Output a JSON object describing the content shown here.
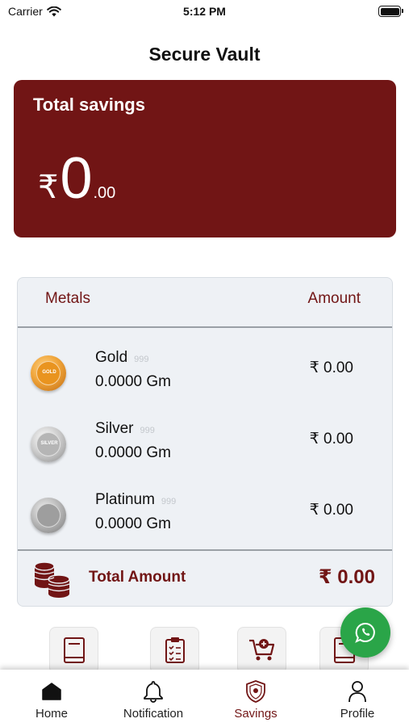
{
  "status_bar": {
    "carrier": "Carrier",
    "time": "5:12 PM"
  },
  "page": {
    "title": "Secure Vault"
  },
  "savings": {
    "label": "Total savings",
    "currency": "₹",
    "integer": "0",
    "decimal": ".00"
  },
  "metals_table": {
    "headers": {
      "metals": "Metals",
      "amount": "Amount"
    },
    "rows": [
      {
        "name": "Gold",
        "purity": "999",
        "weight": "0.0000 Gm",
        "amount": "₹ 0.00",
        "coin_label": "GOLD"
      },
      {
        "name": "Silver",
        "purity": "999",
        "weight": "0.0000 Gm",
        "amount": "₹ 0.00",
        "coin_label": "SILVER"
      },
      {
        "name": "Platinum",
        "purity": "999",
        "weight": "0.0000 Gm",
        "amount": "₹ 0.00",
        "coin_label": ""
      }
    ],
    "total": {
      "label": "Total Amount",
      "value": "₹ 0.00"
    }
  },
  "quick_actions": [
    {
      "icon": "book-icon"
    },
    {
      "icon": "clipboard-checklist-icon"
    },
    {
      "icon": "cart-add-icon"
    },
    {
      "icon": "book-icon"
    }
  ],
  "tabs": [
    {
      "label": "Home",
      "icon": "home-icon",
      "active": false
    },
    {
      "label": "Notification",
      "icon": "bell-icon",
      "active": false
    },
    {
      "label": "Savings",
      "icon": "shield-icon",
      "active": true
    },
    {
      "label": "Profile",
      "icon": "person-icon",
      "active": false
    }
  ],
  "colors": {
    "brand": "#711515",
    "card_bg": "#eef1f5",
    "whatsapp": "#2aa548",
    "text": "#111111"
  }
}
